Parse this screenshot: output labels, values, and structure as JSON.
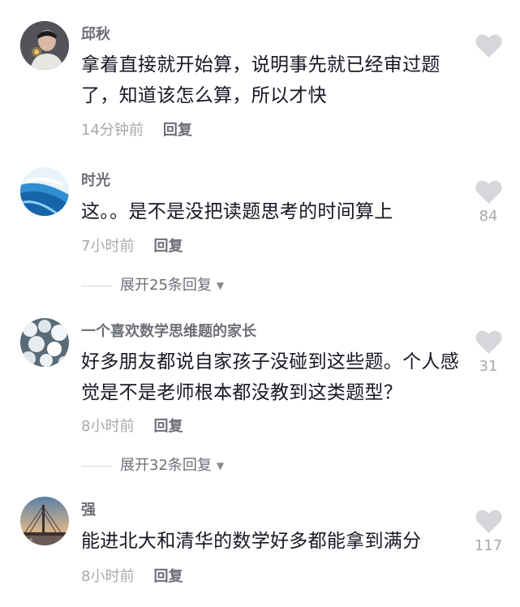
{
  "comments": [
    {
      "username": "邱秋",
      "text": "拿着直接就开始算，说明事先就已经审过题了，知道该怎么算，所以才快",
      "time": "14分钟前",
      "reply_label": "回复",
      "like_count": "",
      "avatar_icon": "avatar-person-photo"
    },
    {
      "username": "时光",
      "text": "这。。是不是没把读题思考的时间算上",
      "time": "7小时前",
      "reply_label": "回复",
      "like_count": "84",
      "expand_label": "展开25条回复",
      "avatar_icon": "avatar-blue-abstract"
    },
    {
      "username": "一个喜欢数学思维题的家长",
      "text": "好多朋友都说自家孩子没碰到这些题。个人感觉是不是老师根本都没教到这类题型？",
      "time": "8小时前",
      "reply_label": "回复",
      "like_count": "31",
      "expand_label": "展开32条回复",
      "avatar_icon": "avatar-snow-texture"
    },
    {
      "username": "强",
      "text": "能进北大和清华的数学好多都能拿到满分",
      "time": "8小时前",
      "reply_label": "回复",
      "like_count": "117",
      "avatar_icon": "avatar-bridge-sunset"
    }
  ],
  "icons": {
    "like": "heart-icon",
    "expand_arrow": "triangle-down-icon"
  },
  "colors": {
    "username": "#6d6f77",
    "text": "#161823",
    "muted": "#a7a9ae",
    "heart": "#d6d7da"
  }
}
